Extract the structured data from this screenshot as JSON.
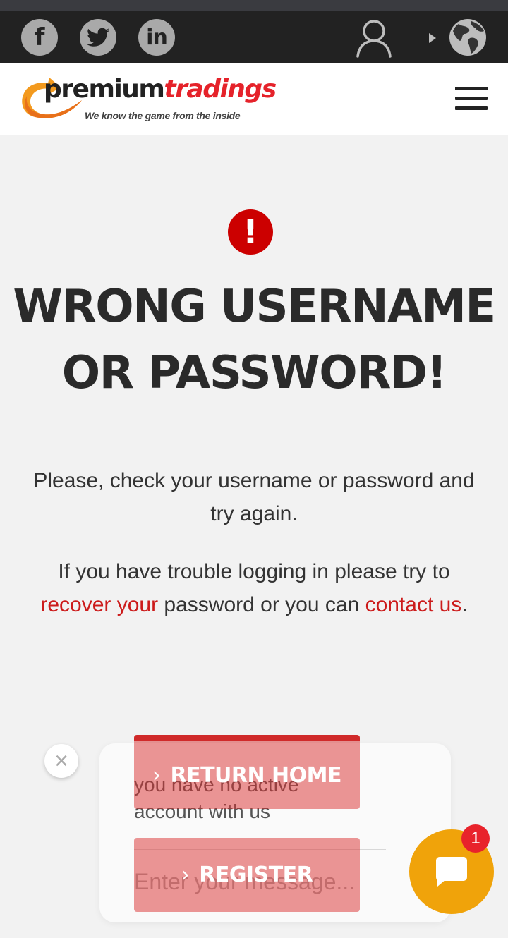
{
  "social": {
    "facebook": "f",
    "twitter_icon": "twitter-bird-icon",
    "linkedin": "in"
  },
  "logo": {
    "part1": "premium",
    "part2": "tradings",
    "tagline": "We know the game from the inside"
  },
  "alert": {
    "symbol": "!",
    "title_line1": "WRONG USERNAME",
    "title_line2": "OR PASSWORD!"
  },
  "message": {
    "line1": "Please, check your username or password and try again.",
    "p2_part1": "If you have trouble logging in please try to ",
    "p2_link1": "recover your",
    "p2_part2": " password or you can ",
    "p2_link2": "contact us",
    "p2_end": "."
  },
  "buttons": {
    "return_home": "RETURN HOME",
    "register": "REGISTER"
  },
  "chat": {
    "status_message": "you have no active account with us",
    "input_placeholder": "Enter your message...",
    "close_symbol": "×",
    "unread_count": "1"
  },
  "colors": {
    "accent_red": "#cc1b1b",
    "chat_orange": "#f0a30a",
    "topbar": "#222222"
  }
}
